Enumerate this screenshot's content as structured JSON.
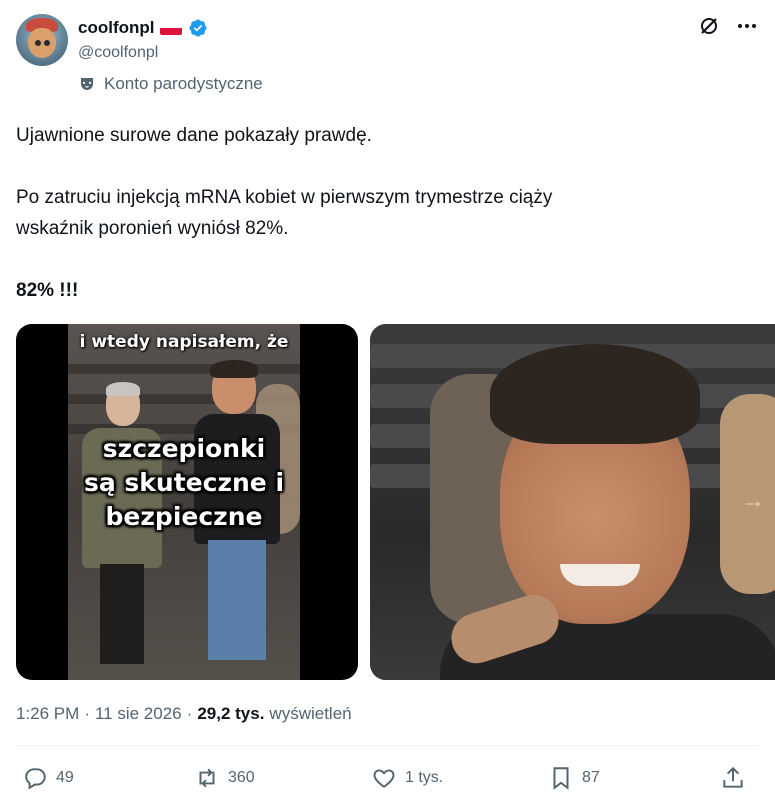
{
  "author": {
    "display_name": "coolfonpl",
    "handle": "@coolfonpl",
    "label": "Konto parodystyczne",
    "flag_icon": "poland-flag-icon",
    "verified_icon": "verified-badge-icon",
    "verified_color": "#1d9bf0"
  },
  "tweet": {
    "line1": "Ujawnione surowe dane pokazały prawdę.",
    "line2": "Po zatruciu injekcją mRNA kobiet w pierwszym trymestrze ciąży",
    "line3": "wskaźnik poronień wyniósł 82%.",
    "line4": "82% !!!"
  },
  "media": {
    "meme_top_text": "i wtedy napisałem, że",
    "meme_main_line1": "szczepionki",
    "meme_main_line2": "są skuteczne i",
    "meme_main_line3": "bezpieczne"
  },
  "meta": {
    "time": "1:26 PM",
    "dot1": "·",
    "date": "11 sie 2026",
    "dot2": "·",
    "views_count": "29,2 tys.",
    "views_label": "wyświetleń"
  },
  "actions": {
    "replies": "49",
    "reposts": "360",
    "likes": "1 tys.",
    "bookmarks": "87"
  },
  "colors": {
    "text_primary": "#0f1419",
    "text_secondary": "#536471",
    "accent": "#1d9bf0"
  }
}
